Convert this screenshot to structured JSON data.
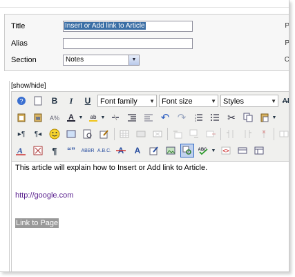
{
  "form": {
    "title_label": "Title",
    "title_value": "Insert or Add link to Article",
    "alias_label": "Alias",
    "alias_value": "",
    "section_label": "Section",
    "section_value": "Notes",
    "side_letters": [
      "P",
      "P",
      "C"
    ]
  },
  "editor": {
    "toggle_label": "[show/hide]",
    "font_family_label": "Font family",
    "font_size_label": "Font size",
    "styles_label": "Styles",
    "content": {
      "paragraph": "This article will explain how to Insert or Add link to Article.",
      "link": "http://google.com",
      "highlighted": "Link to Page"
    }
  },
  "colors": {
    "link": "#551a8b",
    "selection": "#3a6ea5",
    "toolbar_bg": "#f0f0ee"
  }
}
